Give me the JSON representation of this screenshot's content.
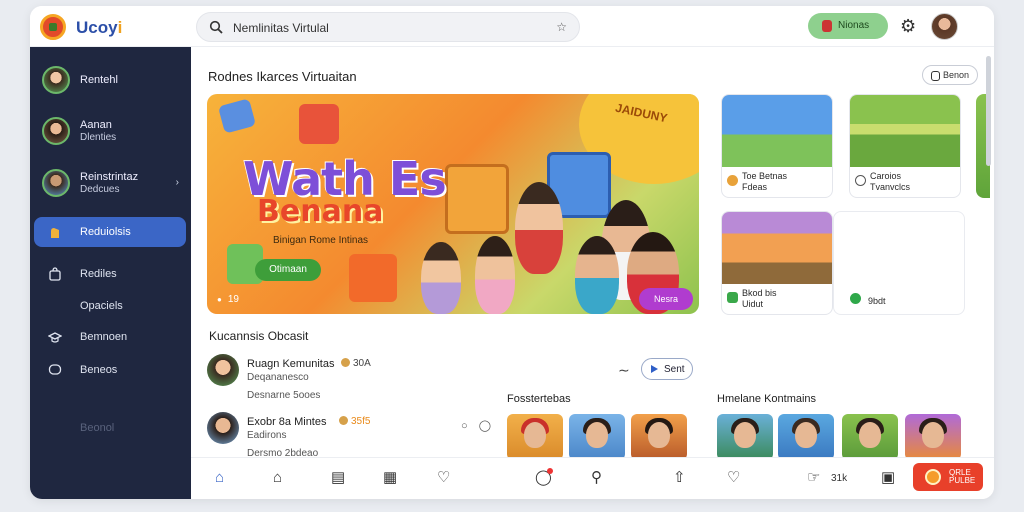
{
  "app": {
    "brand_a": "Ucoy",
    "brand_b": "i"
  },
  "search": {
    "value": "Nemlinitas Virtulal"
  },
  "topbar": {
    "primary_button": "Nionas"
  },
  "sidebar": {
    "users": [
      {
        "line1": "Rentehl",
        "line2": ""
      },
      {
        "line1": "Aanan",
        "line2": "Dlenties"
      },
      {
        "line1": "Reinstrintaz",
        "line2": "Dedcues"
      }
    ],
    "items": [
      {
        "label": "Reduiolsis"
      },
      {
        "label": "Rediles"
      },
      {
        "label": "Opaciels"
      },
      {
        "label": "Bemnoen"
      },
      {
        "label": "Beneos"
      },
      {
        "label": "Beonol"
      }
    ]
  },
  "main": {
    "section_title": "Rodnes Ikarces Virtuaitan",
    "section_button": "Benon",
    "hero": {
      "badge": "JAIDUNY",
      "title": "Wath Es",
      "title2": "Benana",
      "subtitle": "Binigan Rome Intinas",
      "cta": "Otimaan",
      "meta": "19",
      "tag": "Nesra"
    },
    "cards": [
      {
        "line1": "Toe Betnas",
        "line2": "Fdeas"
      },
      {
        "line1": "Caroios",
        "line2": "Tvanvclcs"
      },
      {
        "line1": "Bkod bis",
        "line2": "Uidut"
      },
      {
        "line1": "9bdt",
        "line2": ""
      }
    ],
    "feed": {
      "title": "Kucannsis Obcasit",
      "rows": [
        {
          "name": "Ruagn Kemunitas",
          "count": "30A",
          "sub1": "Deqananesco",
          "sub2": "Desnarne 5ooes"
        },
        {
          "name": "Exobr 8a Mintes",
          "count": "35f5",
          "sub1": "Eadirons",
          "sub2": "Dersmo 2bdeao"
        }
      ],
      "send": "Sent"
    },
    "strips": [
      {
        "title": "Fosstertebas"
      },
      {
        "title": "Hmelane Kontmains"
      }
    ]
  },
  "bottombar": {
    "count": "31k",
    "live_line1": "QRLE",
    "live_line2": "PULBE"
  },
  "colors": {
    "sidebar_bg": "#1f2740",
    "accent": "#3b66c6",
    "green_button": "#8ed08e",
    "live_button": "#e8402a"
  }
}
